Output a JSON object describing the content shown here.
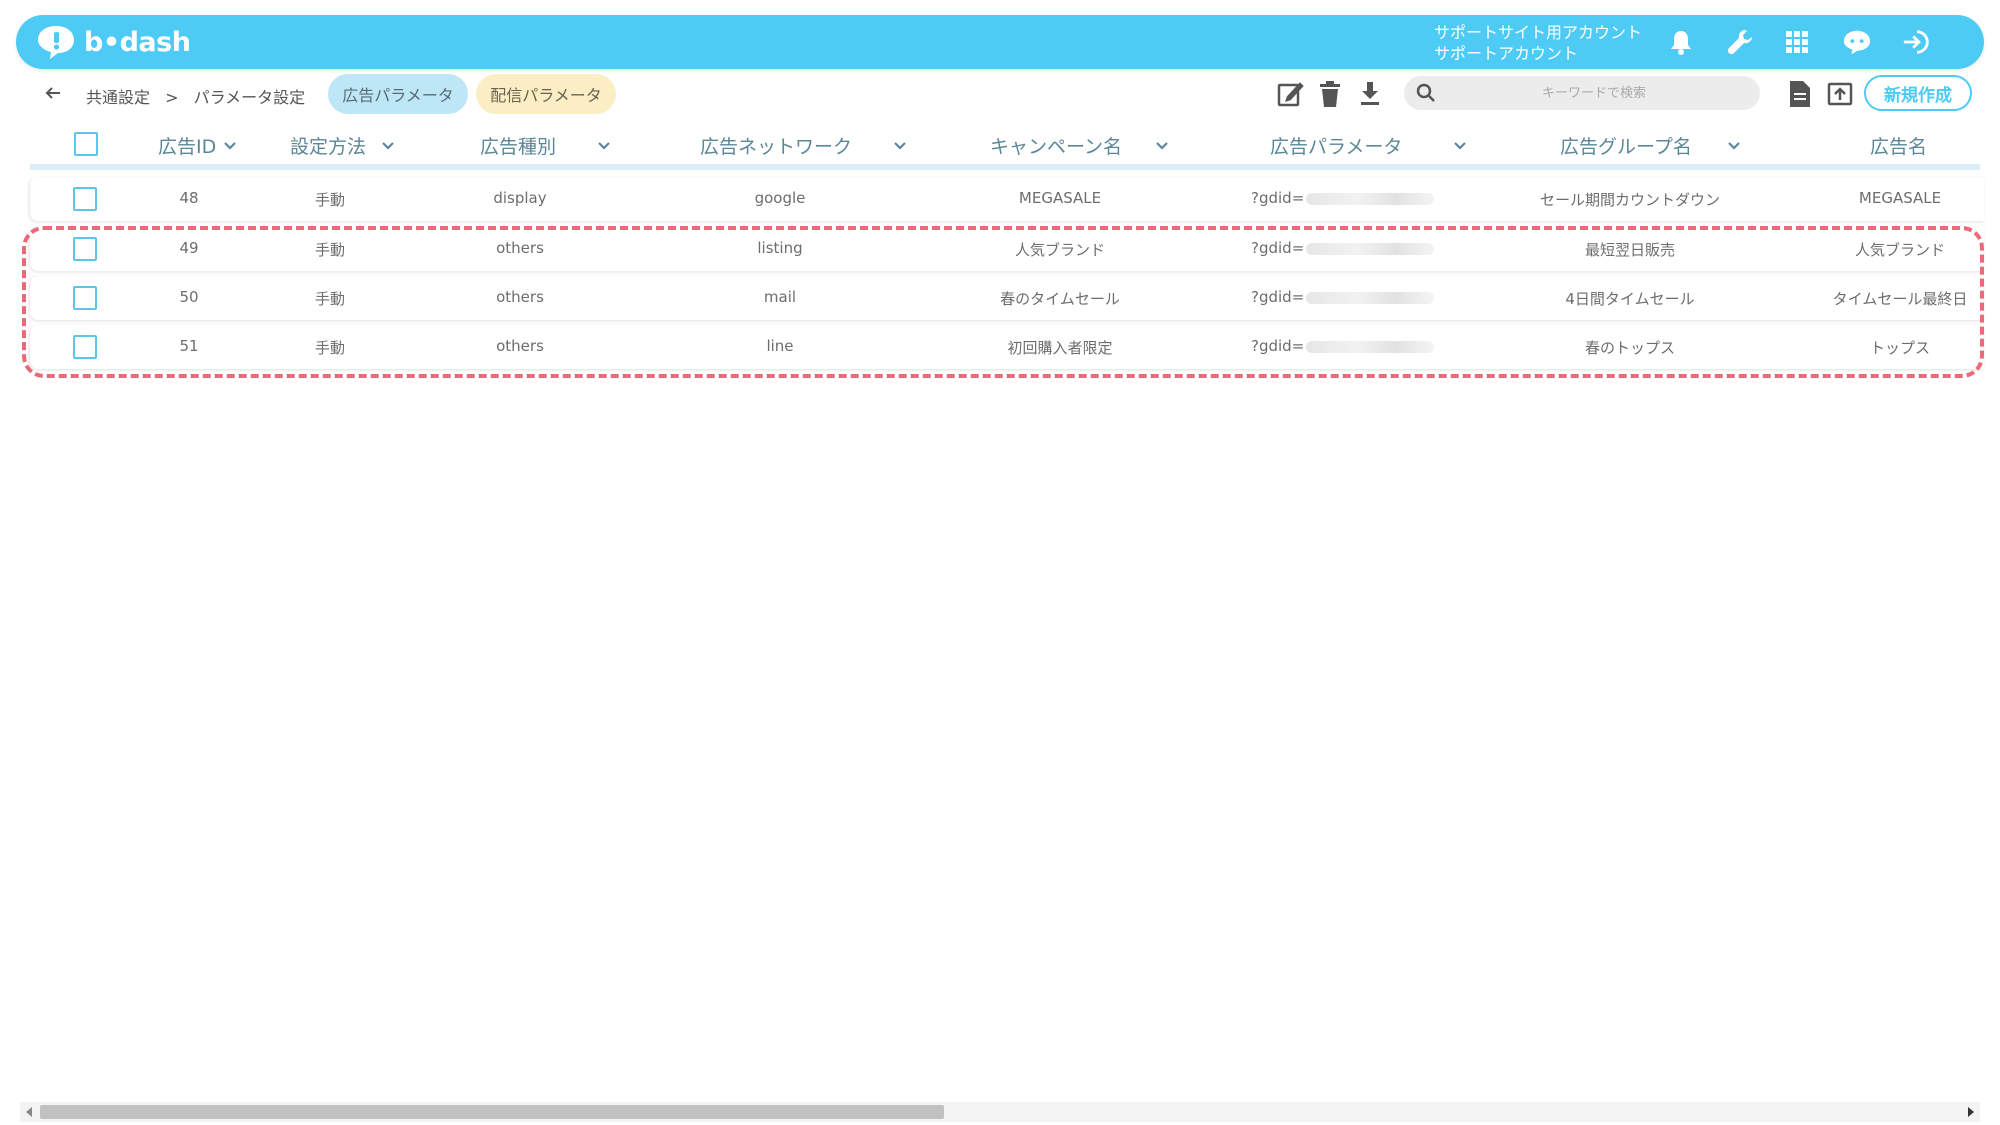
{
  "app": {
    "logo_text": "b•dash"
  },
  "header": {
    "account_line1": "サポートサイト用アカウント",
    "account_line2": "サポートアカウント",
    "icons": [
      "bell-icon",
      "wrench-icon",
      "apps-grid-icon",
      "support-chat-icon",
      "logout-icon"
    ]
  },
  "breadcrumb": {
    "items": [
      "共通設定",
      ">",
      "パラメータ設定"
    ]
  },
  "tabs": [
    {
      "label": "広告パラメータ",
      "active": true
    },
    {
      "label": "配信パラメータ",
      "active": false
    }
  ],
  "toolbar": {
    "icons": [
      "edit-icon",
      "trash-icon",
      "download-icon",
      "document-icon",
      "upload-icon"
    ],
    "search_placeholder": "キーワードで検索",
    "new_button": "新規作成"
  },
  "table": {
    "columns": [
      "広告ID",
      "設定方法",
      "広告種別",
      "広告ネットワーク",
      "キャンペーン名",
      "広告パラメータ",
      "広告グループ名",
      "広告名"
    ],
    "rows": [
      {
        "id": "48",
        "method": "手動",
        "type": "display",
        "network": "google",
        "campaign": "MEGASALE",
        "param": "?gdid=",
        "group": "セール期間カウントダウン",
        "ad": "MEGASALE"
      },
      {
        "id": "49",
        "method": "手動",
        "type": "others",
        "network": "listing",
        "campaign": "人気ブランド",
        "param": "?gdid=",
        "group": "最短翌日販売",
        "ad": "人気ブランド"
      },
      {
        "id": "50",
        "method": "手動",
        "type": "others",
        "network": "mail",
        "campaign": "春のタイムセール",
        "param": "?gdid=",
        "group": "4日間タイムセール",
        "ad": "タイムセール最終日"
      },
      {
        "id": "51",
        "method": "手動",
        "type": "others",
        "network": "line",
        "campaign": "初回購入者限定",
        "param": "?gdid=",
        "group": "春のトップス",
        "ad": "トップス"
      }
    ]
  },
  "colors": {
    "brand": "#4dcbf4",
    "highlight": "#ea6a7a",
    "tab_active": "#bde7f6",
    "tab_inactive": "#fbedc4"
  }
}
